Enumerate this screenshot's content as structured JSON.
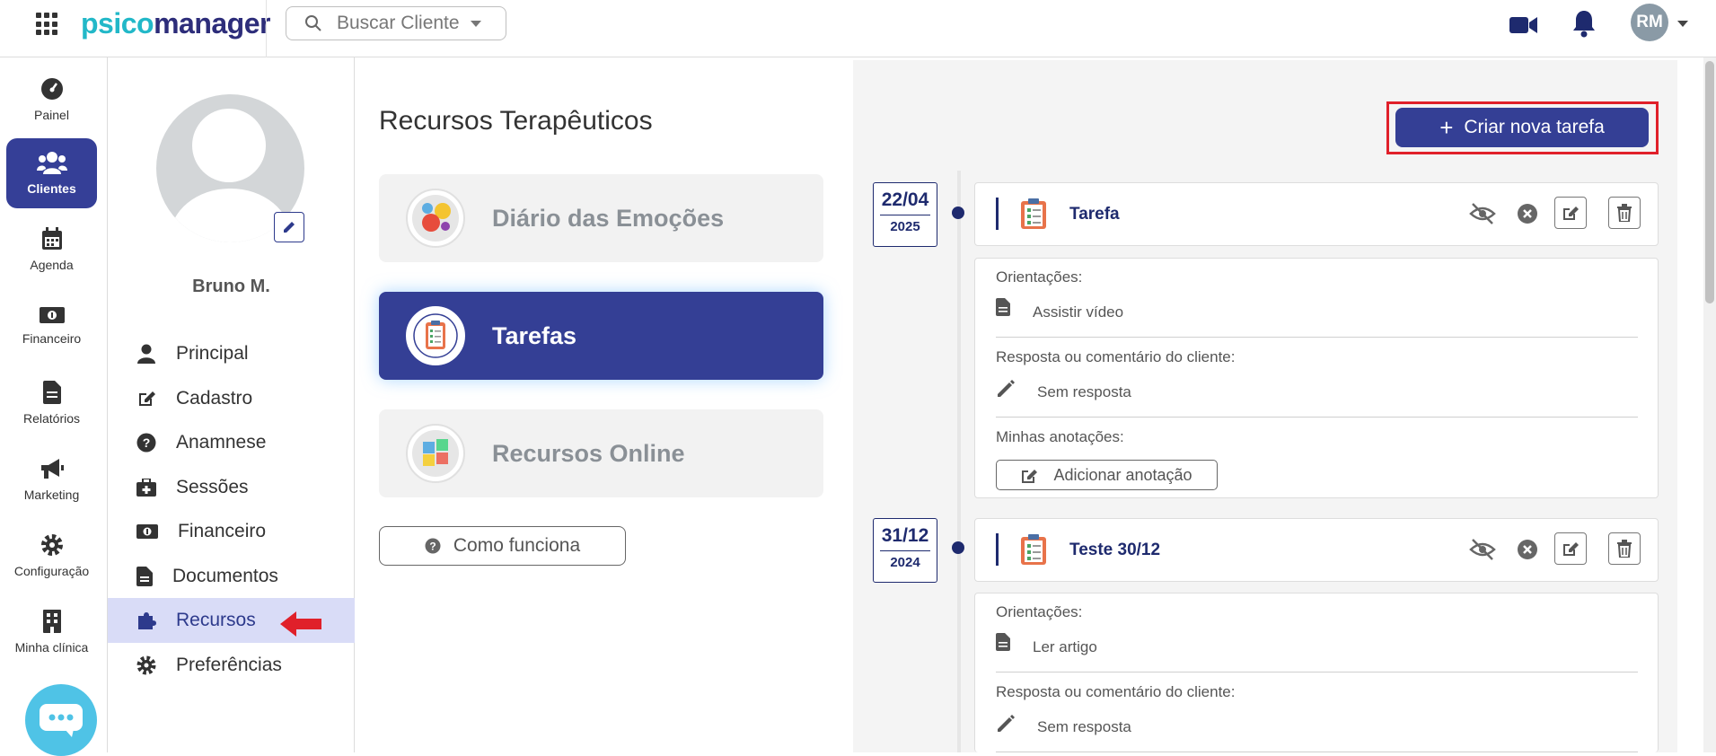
{
  "header": {
    "logo_part1": "psico",
    "logo_part2": "manager",
    "search_placeholder": "Buscar Cliente",
    "avatar_initials": "RM"
  },
  "rail": {
    "items": [
      {
        "label": "Painel",
        "icon": "gauge-icon"
      },
      {
        "label": "Clientes",
        "icon": "users-icon",
        "active": true
      },
      {
        "label": "Agenda",
        "icon": "calendar-icon"
      },
      {
        "label": "Financeiro",
        "icon": "money-icon"
      },
      {
        "label": "Relatórios",
        "icon": "document-icon"
      },
      {
        "label": "Marketing",
        "icon": "megaphone-icon"
      },
      {
        "label": "Configuração",
        "icon": "gear-icon"
      },
      {
        "label": "Minha clínica",
        "icon": "building-icon"
      }
    ]
  },
  "client": {
    "name": "Bruno M.",
    "menu": [
      {
        "label": "Principal",
        "icon": "user-icon"
      },
      {
        "label": "Cadastro",
        "icon": "edit-icon"
      },
      {
        "label": "Anamnese",
        "icon": "question-icon"
      },
      {
        "label": "Sessões",
        "icon": "medkit-icon"
      },
      {
        "label": "Financeiro",
        "icon": "money-icon"
      },
      {
        "label": "Documentos",
        "icon": "document-icon"
      },
      {
        "label": "Recursos",
        "icon": "puzzle-icon",
        "active": true
      },
      {
        "label": "Preferências",
        "icon": "gear-icon"
      }
    ]
  },
  "resources": {
    "title": "Recursos Terapêuticos",
    "cards": [
      {
        "label": "Diário das Emoções"
      },
      {
        "label": "Tarefas",
        "active": true
      },
      {
        "label": "Recursos Online"
      }
    ],
    "how_it_works": "Como funciona"
  },
  "tasks": {
    "create_label": "Criar nova tarefa",
    "guidance_label": "Orientações:",
    "response_label": "Resposta ou comentário do cliente:",
    "notes_label": "Minhas anotações:",
    "add_note_label": "Adicionar anotação",
    "items": [
      {
        "day_month": "22/04",
        "year": "2025",
        "title": "Tarefa",
        "guidance": "Assistir vídeo",
        "response": "Sem resposta"
      },
      {
        "day_month": "31/12",
        "year": "2024",
        "title": "Teste 30/12",
        "guidance": "Ler artigo",
        "response": "Sem resposta"
      }
    ]
  },
  "colors": {
    "primary": "#343f95",
    "accent": "#22b8c8",
    "highlight_border": "#e0202a"
  }
}
